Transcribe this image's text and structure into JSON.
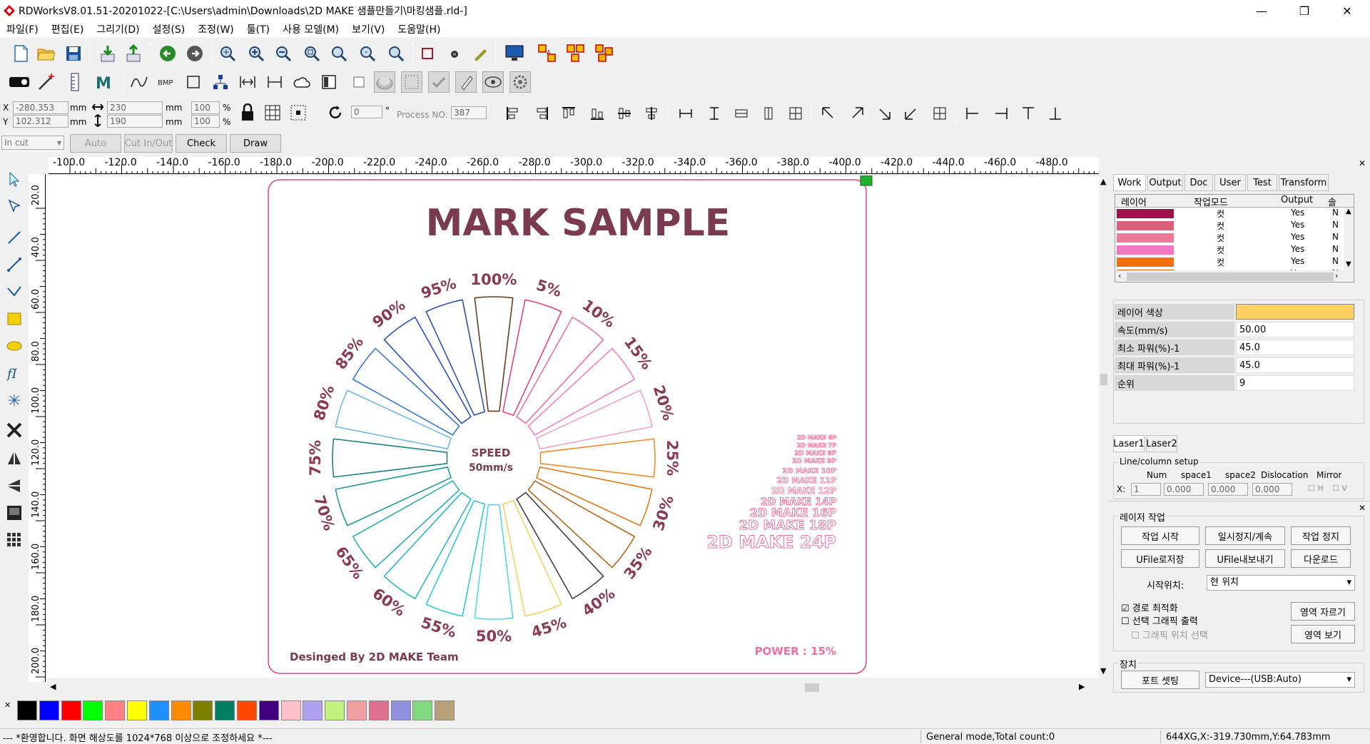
{
  "window": {
    "title": "RDWorksV8.01.51-20201022-[C:\\Users\\admin\\Downloads\\2D MAKE 샘플만들기\\마킹샘플.rld-]",
    "min": "—",
    "max": "❐",
    "close": "✕"
  },
  "menu": [
    "파일(F)",
    "편집(E)",
    "그리기(D)",
    "설정(S)",
    "조정(W)",
    "툴(T)",
    "사용 모델(M)",
    "보기(V)",
    "도움말(H)"
  ],
  "toolbar3": {
    "x_label": "X",
    "y_label": "Y",
    "x_value": "-280.353",
    "y_value": "102.312",
    "w_value": "230",
    "h_value": "190",
    "mm": "mm",
    "scale_x": "100",
    "scale_y": "100",
    "pct": "%",
    "rotate_value": "0",
    "deg": "°",
    "process_no_label": "Process NO:",
    "process_no": "387"
  },
  "toolbar4": {
    "mode_select": "In cut",
    "auto": "Auto",
    "cut_in_out": "Cut In/Out",
    "check": "Check",
    "draw": "Draw"
  },
  "ruler_h": [
    "-100.0",
    "-120.0",
    "-140.0",
    "-160.0",
    "-180.0",
    "-200.0",
    "-220.0",
    "-240.0",
    "-260.0",
    "-280.0",
    "-300.0",
    "-320.0",
    "-340.0",
    "-360.0",
    "-380.0",
    "-400.0",
    "-420.0",
    "-440.0",
    "-460.0",
    "-480.0"
  ],
  "ruler_v": [
    "20.0",
    "40.0",
    "60.0",
    "80.0",
    "100.0",
    "120.0",
    "140.0",
    "160.0",
    "180.0",
    "200.0"
  ],
  "design": {
    "title": "MARK SAMPLE",
    "speed": "SPEED",
    "speed_val": "50mm/s",
    "percent_labels": [
      "100%",
      "5%",
      "10%",
      "15%",
      "20%",
      "25%",
      "30%",
      "35%",
      "40%",
      "45%",
      "50%",
      "55%",
      "60%",
      "65%",
      "70%",
      "75%",
      "80%",
      "85%",
      "90%",
      "95%"
    ],
    "wedge_colors": [
      "#6b3a1f",
      "#e8437a",
      "#f06ea0",
      "#f080c8",
      "#f8a0c8",
      "#f08c28",
      "#e07818",
      "#b06818",
      "#404040",
      "#f8d060",
      "#50d8e8",
      "#30c8e0",
      "#28b8c8",
      "#28b0b0",
      "#209898",
      "#208080",
      "#70b8e8",
      "#3878d0",
      "#2850c0",
      "#3050a8"
    ],
    "label_color": "#8a3a55",
    "size_samples": [
      "2D MAKE 6P",
      "2D MAKE 7P",
      "2D MAKE 8P",
      "2D MAKE 9P",
      "2D MAKE 10P",
      "2D MAKE 11P",
      "2D MAKE 12P",
      "2D MAKE 14P",
      "2D MAKE 16P",
      "2D MAKE 18P",
      "2D MAKE 24P"
    ],
    "power": "POWER : 15%",
    "credit": "Desinged By 2D MAKE Team"
  },
  "panel": {
    "tabs": [
      "Work",
      "Output",
      "Doc",
      "User",
      "Test",
      "Transform"
    ],
    "layer_headers": [
      "레이어",
      "작업모드",
      "Output",
      "솔"
    ],
    "layers": [
      {
        "color": "#a0104a",
        "mode": "컷",
        "output": "Yes",
        "extra": "N"
      },
      {
        "color": "#d8607a",
        "mode": "컷",
        "output": "Yes",
        "extra": "N"
      },
      {
        "color": "#f07898",
        "mode": "컷",
        "output": "Yes",
        "extra": "N"
      },
      {
        "color": "#f078c0",
        "mode": "컷",
        "output": "Yes",
        "extra": "N"
      },
      {
        "color": "#f07010",
        "mode": "컷",
        "output": "Yes",
        "extra": "N"
      },
      {
        "color": "#e06010",
        "mode": "컷",
        "output": "Yes",
        "extra": "N"
      }
    ],
    "props": [
      {
        "k": "레이어 색상",
        "v": ""
      },
      {
        "k": "속도(mm/s)",
        "v": "50.00"
      },
      {
        "k": "최소 파워(%)-1",
        "v": "45.0"
      },
      {
        "k": "최대 파워(%)-1",
        "v": "45.0"
      },
      {
        "k": "순위",
        "v": "9"
      }
    ],
    "layer_color_hex": "#ffd060",
    "laser_tabs": [
      "Laser1",
      "Laser2"
    ],
    "line_col_setup": "Line/column setup",
    "lc_headers": [
      "Num",
      "space1",
      "space2",
      "Dislocation",
      "Mirror"
    ],
    "lc_x": "X:",
    "lc_values": [
      "1",
      "0.000",
      "0.000",
      "0.000"
    ],
    "mirror_h": "H",
    "mirror_v": "V"
  },
  "laser_work": {
    "title": "레이저 작업",
    "buttons": [
      "작업 시작",
      "일시정지/계속",
      "작업 정지",
      "UFile로저장",
      "UFile내보내기",
      "다운로드"
    ],
    "start_pos_label": "시작위치:",
    "start_pos_value": "현 위치",
    "chk_path": "경로 최적화",
    "chk_select": "선택 그래픽 출력",
    "chk_graphic_pos": "그래픽 위치 선택",
    "cut_area": "영역 자르기",
    "view_area": "영역 보기",
    "device_title": "장치",
    "port_setting": "포트 셋팅",
    "device_value": "Device---(USB:Auto)"
  },
  "palette": [
    "#000000",
    "#0000ff",
    "#ff0000",
    "#00ff00",
    "#ff8080",
    "#ffff00",
    "#1e90ff",
    "#ff8c00",
    "#808000",
    "#008060",
    "#ff4500",
    "#400080",
    "#ffc0cb",
    "#b0a0f0",
    "#c0f080",
    "#f0a0a0",
    "#e07090",
    "#9090e0",
    "#80d880",
    "#b8a078"
  ],
  "status": {
    "left": "--- *환영합니다. 화면 해상도를 1024*768 이상으로 조정하세요 *---",
    "mid": "General mode,Total count:0",
    "right": "644XG,X:-319.730mm,Y:64.783mm"
  }
}
